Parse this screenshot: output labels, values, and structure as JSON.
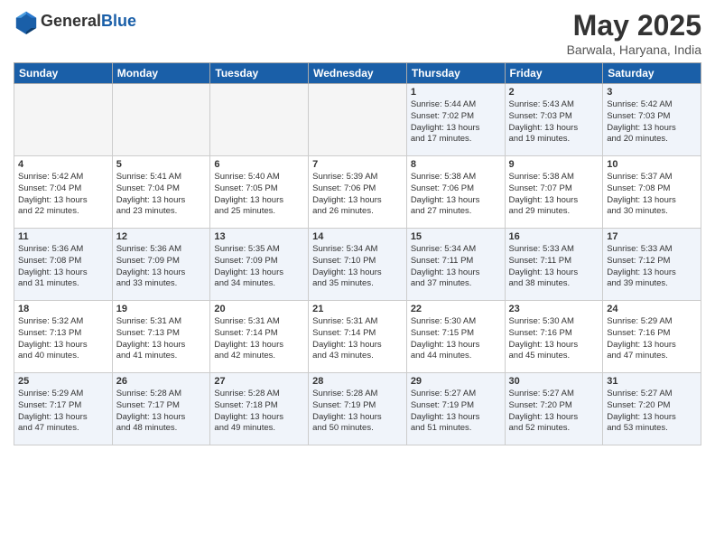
{
  "header": {
    "logo_line1": "General",
    "logo_line2": "Blue",
    "title": "May 2025",
    "location": "Barwala, Haryana, India"
  },
  "days_of_week": [
    "Sunday",
    "Monday",
    "Tuesday",
    "Wednesday",
    "Thursday",
    "Friday",
    "Saturday"
  ],
  "weeks": [
    [
      {
        "day": "",
        "info": ""
      },
      {
        "day": "",
        "info": ""
      },
      {
        "day": "",
        "info": ""
      },
      {
        "day": "",
        "info": ""
      },
      {
        "day": "1",
        "info": "Sunrise: 5:44 AM\nSunset: 7:02 PM\nDaylight: 13 hours\nand 17 minutes."
      },
      {
        "day": "2",
        "info": "Sunrise: 5:43 AM\nSunset: 7:03 PM\nDaylight: 13 hours\nand 19 minutes."
      },
      {
        "day": "3",
        "info": "Sunrise: 5:42 AM\nSunset: 7:03 PM\nDaylight: 13 hours\nand 20 minutes."
      }
    ],
    [
      {
        "day": "4",
        "info": "Sunrise: 5:42 AM\nSunset: 7:04 PM\nDaylight: 13 hours\nand 22 minutes."
      },
      {
        "day": "5",
        "info": "Sunrise: 5:41 AM\nSunset: 7:04 PM\nDaylight: 13 hours\nand 23 minutes."
      },
      {
        "day": "6",
        "info": "Sunrise: 5:40 AM\nSunset: 7:05 PM\nDaylight: 13 hours\nand 25 minutes."
      },
      {
        "day": "7",
        "info": "Sunrise: 5:39 AM\nSunset: 7:06 PM\nDaylight: 13 hours\nand 26 minutes."
      },
      {
        "day": "8",
        "info": "Sunrise: 5:38 AM\nSunset: 7:06 PM\nDaylight: 13 hours\nand 27 minutes."
      },
      {
        "day": "9",
        "info": "Sunrise: 5:38 AM\nSunset: 7:07 PM\nDaylight: 13 hours\nand 29 minutes."
      },
      {
        "day": "10",
        "info": "Sunrise: 5:37 AM\nSunset: 7:08 PM\nDaylight: 13 hours\nand 30 minutes."
      }
    ],
    [
      {
        "day": "11",
        "info": "Sunrise: 5:36 AM\nSunset: 7:08 PM\nDaylight: 13 hours\nand 31 minutes."
      },
      {
        "day": "12",
        "info": "Sunrise: 5:36 AM\nSunset: 7:09 PM\nDaylight: 13 hours\nand 33 minutes."
      },
      {
        "day": "13",
        "info": "Sunrise: 5:35 AM\nSunset: 7:09 PM\nDaylight: 13 hours\nand 34 minutes."
      },
      {
        "day": "14",
        "info": "Sunrise: 5:34 AM\nSunset: 7:10 PM\nDaylight: 13 hours\nand 35 minutes."
      },
      {
        "day": "15",
        "info": "Sunrise: 5:34 AM\nSunset: 7:11 PM\nDaylight: 13 hours\nand 37 minutes."
      },
      {
        "day": "16",
        "info": "Sunrise: 5:33 AM\nSunset: 7:11 PM\nDaylight: 13 hours\nand 38 minutes."
      },
      {
        "day": "17",
        "info": "Sunrise: 5:33 AM\nSunset: 7:12 PM\nDaylight: 13 hours\nand 39 minutes."
      }
    ],
    [
      {
        "day": "18",
        "info": "Sunrise: 5:32 AM\nSunset: 7:13 PM\nDaylight: 13 hours\nand 40 minutes."
      },
      {
        "day": "19",
        "info": "Sunrise: 5:31 AM\nSunset: 7:13 PM\nDaylight: 13 hours\nand 41 minutes."
      },
      {
        "day": "20",
        "info": "Sunrise: 5:31 AM\nSunset: 7:14 PM\nDaylight: 13 hours\nand 42 minutes."
      },
      {
        "day": "21",
        "info": "Sunrise: 5:31 AM\nSunset: 7:14 PM\nDaylight: 13 hours\nand 43 minutes."
      },
      {
        "day": "22",
        "info": "Sunrise: 5:30 AM\nSunset: 7:15 PM\nDaylight: 13 hours\nand 44 minutes."
      },
      {
        "day": "23",
        "info": "Sunrise: 5:30 AM\nSunset: 7:16 PM\nDaylight: 13 hours\nand 45 minutes."
      },
      {
        "day": "24",
        "info": "Sunrise: 5:29 AM\nSunset: 7:16 PM\nDaylight: 13 hours\nand 47 minutes."
      }
    ],
    [
      {
        "day": "25",
        "info": "Sunrise: 5:29 AM\nSunset: 7:17 PM\nDaylight: 13 hours\nand 47 minutes."
      },
      {
        "day": "26",
        "info": "Sunrise: 5:28 AM\nSunset: 7:17 PM\nDaylight: 13 hours\nand 48 minutes."
      },
      {
        "day": "27",
        "info": "Sunrise: 5:28 AM\nSunset: 7:18 PM\nDaylight: 13 hours\nand 49 minutes."
      },
      {
        "day": "28",
        "info": "Sunrise: 5:28 AM\nSunset: 7:19 PM\nDaylight: 13 hours\nand 50 minutes."
      },
      {
        "day": "29",
        "info": "Sunrise: 5:27 AM\nSunset: 7:19 PM\nDaylight: 13 hours\nand 51 minutes."
      },
      {
        "day": "30",
        "info": "Sunrise: 5:27 AM\nSunset: 7:20 PM\nDaylight: 13 hours\nand 52 minutes."
      },
      {
        "day": "31",
        "info": "Sunrise: 5:27 AM\nSunset: 7:20 PM\nDaylight: 13 hours\nand 53 minutes."
      }
    ]
  ],
  "alt_rows": [
    0,
    2,
    4
  ],
  "empty_days_week0": [
    0,
    1,
    2,
    3
  ]
}
